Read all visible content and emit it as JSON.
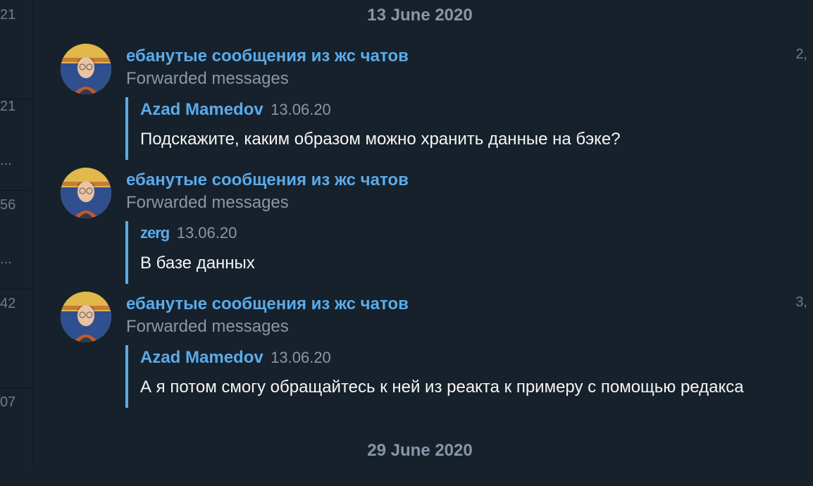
{
  "sidebar": {
    "items": [
      {
        "time": "21",
        "dots": ""
      },
      {
        "time": "21",
        "dots": "..."
      },
      {
        "time": "56",
        "dots": "..."
      },
      {
        "time": "42",
        "dots": ""
      },
      {
        "time": "07",
        "dots": ""
      }
    ]
  },
  "date_separators": [
    "13 June 2020",
    "29 June 2020"
  ],
  "messages": [
    {
      "sender": "ебанутые сообщения из жс чатов",
      "forward_label": "Forwarded messages",
      "quote_author": "Azad Mamedov",
      "quote_date": "13.06.20",
      "quote_text": "Подскажите, каким образом можно хранить данные на бэке?",
      "side_time": "2,"
    },
    {
      "sender": "ебанутые сообщения из жс чатов",
      "forward_label": "Forwarded messages",
      "quote_author": "zerg",
      "quote_date": "13.06.20",
      "quote_text": "В базе данных",
      "side_time": ""
    },
    {
      "sender": "ебанутые сообщения из жс чатов",
      "forward_label": "Forwarded messages",
      "quote_author": "Azad Mamedov",
      "quote_date": "13.06.20",
      "quote_text": "А я потом смогу обращайтесь к ней из реакта к примеру с помощью редакса",
      "side_time": "3,"
    }
  ],
  "colors": {
    "background": "#17212b",
    "accent": "#5aabea",
    "muted": "#8b97a5",
    "text": "#f5f5f5"
  }
}
